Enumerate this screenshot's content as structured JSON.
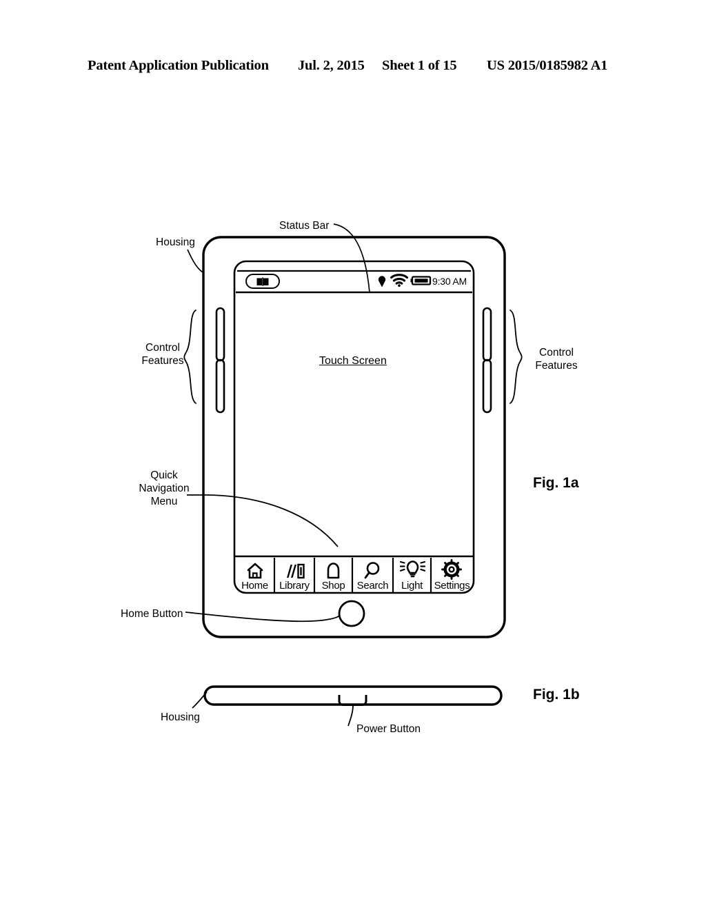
{
  "header": {
    "publication": "Patent Application Publication",
    "date": "Jul. 2, 2015",
    "sheet": "Sheet 1 of 15",
    "number": "US 2015/0185982 A1"
  },
  "figures": {
    "fig_1a_label": "Fig. 1a",
    "fig_1b_label": "Fig. 1b"
  },
  "annotations": {
    "status_bar": "Status Bar",
    "housing_a": "Housing",
    "control_features_left": "Control\nFeatures",
    "control_features_right": "Control\nFeatures",
    "quick_navigation_menu": "Quick\nNavigation\nMenu",
    "home_button": "Home Button",
    "housing_b": "Housing",
    "power_button": "Power Button"
  },
  "device": {
    "screen_caption": "Touch Screen",
    "status_bar": {
      "book_icon": "open-book-icon",
      "indicator_icons": [
        "reading-light-icon",
        "wifi-icon",
        "battery-icon"
      ],
      "time": "9:30 AM"
    },
    "quick_nav": {
      "items": [
        {
          "label": "Home",
          "icon": "house-icon"
        },
        {
          "label": "Library",
          "icon": "books-icon"
        },
        {
          "label": "Shop",
          "icon": "shopping-bag-icon"
        },
        {
          "label": "Search",
          "icon": "magnifier-icon"
        },
        {
          "label": "Light",
          "icon": "lightbulb-icon"
        },
        {
          "label": "Settings",
          "icon": "gear-icon"
        }
      ]
    },
    "control_features": {
      "left_buttons": 2,
      "right_buttons": 2
    }
  },
  "colors": {
    "ink": "#000000",
    "paper": "#ffffff"
  }
}
